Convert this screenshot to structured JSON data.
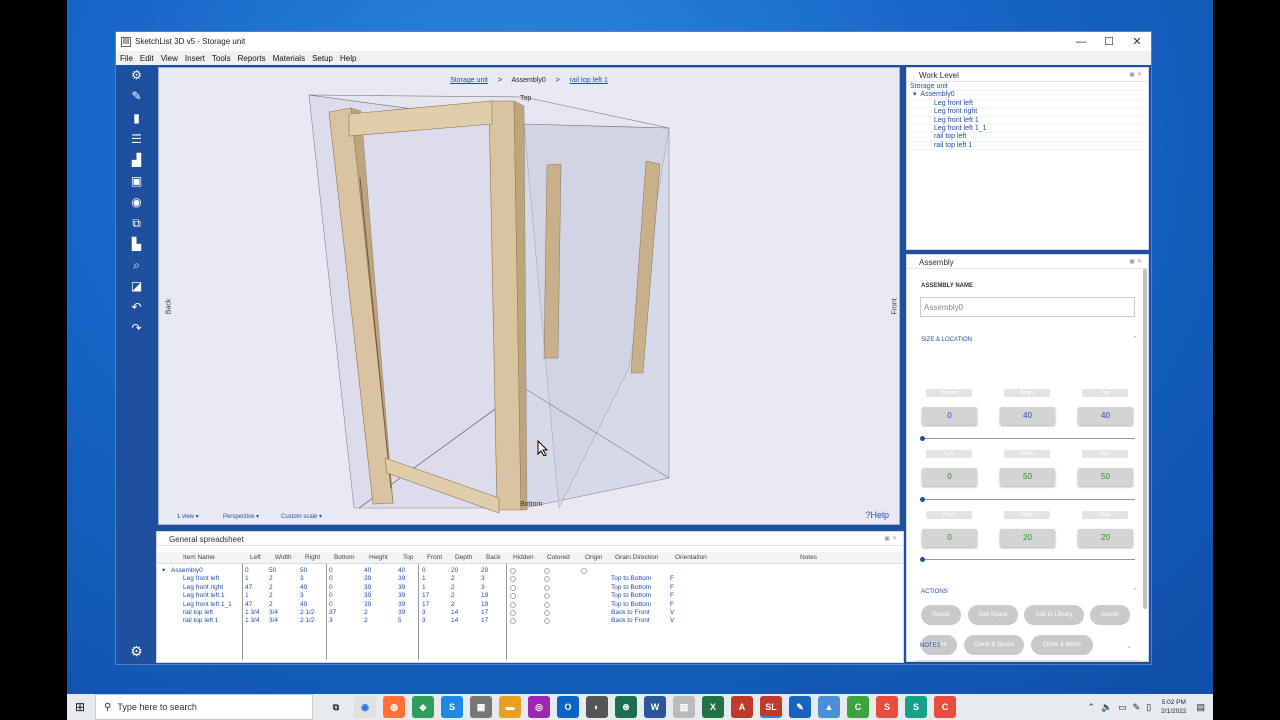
{
  "window": {
    "title": "SketchList 3D v5 - Storage unit",
    "controls": {
      "minimize": "—",
      "maximize": "☐",
      "close": "✕"
    }
  },
  "menu": [
    "File",
    "Edit",
    "View",
    "Insert",
    "Tools",
    "Reports",
    "Materials",
    "Setup",
    "Help"
  ],
  "viewport": {
    "breadcrumbs": [
      "Storage unit",
      "Assembly0",
      "rail top left 1"
    ],
    "crumb_sep": ">",
    "label_back": "Back",
    "label_front": "Front",
    "label_top": "Top",
    "label_bottom": "Bottom",
    "view_menu": "1 view",
    "projection_menu": "Perspective",
    "scale_menu": "Custom scale",
    "help": "?Help"
  },
  "work_level": {
    "title": "Work Level",
    "root": "Storage unit",
    "assembly": "Assembly0",
    "items": [
      "Leg front left",
      "Leg front right",
      "Leg front left 1",
      "Leg front left 1_1",
      "rail top left",
      "rail top left 1"
    ]
  },
  "assembly_panel": {
    "title": "Assembly",
    "name_label": "ASSEMBLY NAME",
    "name_value": "Assembly0",
    "size_section": "SIZE & LOCATION",
    "rows": [
      {
        "caps": [
          "Bottom",
          "Height",
          "Top"
        ],
        "values": [
          "0",
          "40",
          "40"
        ]
      },
      {
        "caps": [
          "Left",
          "Width",
          "Right"
        ],
        "values": [
          "0",
          "50",
          "50"
        ]
      },
      {
        "caps": [
          "Front",
          "Depth",
          "Back"
        ],
        "values": [
          "0",
          "20",
          "20"
        ]
      }
    ],
    "actions_section": "ACTIONS",
    "actions": [
      "Resize",
      "Add Space",
      "Add to Library",
      "Delete",
      "Clone",
      "Clone & Space",
      "Clone & Mirror"
    ],
    "notes_section": "NOTES"
  },
  "spreadsheet": {
    "title": "General spreadsheet",
    "columns": [
      "Item Name",
      "Left",
      "Width",
      "Right",
      "Bottom",
      "Height",
      "Top",
      "Front",
      "Depth",
      "Back",
      "Hidden",
      "Colored",
      "Origin",
      "Grain Direction",
      "Orientation",
      "Notes"
    ],
    "rows": [
      {
        "name": "Assembly0",
        "left": "0",
        "width": "50",
        "right": "50",
        "bottom": "0",
        "height": "40",
        "top": "40",
        "front": "0",
        "depth": "20",
        "back": "20",
        "grain": "",
        "orient": ""
      },
      {
        "name": "Leg front left",
        "left": "1",
        "width": "2",
        "right": "3",
        "bottom": "0",
        "height": "39",
        "top": "39",
        "front": "1",
        "depth": "2",
        "back": "3",
        "grain": "Top to Bottom",
        "orient": "F"
      },
      {
        "name": "Leg front right",
        "left": "47",
        "width": "2",
        "right": "49",
        "bottom": "0",
        "height": "39",
        "top": "39",
        "front": "1",
        "depth": "2",
        "back": "3",
        "grain": "Top to Bottom",
        "orient": "F"
      },
      {
        "name": "Leg front left 1",
        "left": "1",
        "width": "2",
        "right": "3",
        "bottom": "0",
        "height": "39",
        "top": "39",
        "front": "17",
        "depth": "2",
        "back": "19",
        "grain": "Top to Bottom",
        "orient": "F"
      },
      {
        "name": "Leg front left 1_1",
        "left": "47",
        "width": "2",
        "right": "49",
        "bottom": "0",
        "height": "39",
        "top": "39",
        "front": "17",
        "depth": "2",
        "back": "19",
        "grain": "Top to Bottom",
        "orient": "F"
      },
      {
        "name": "rail top left",
        "left": "1 3/4",
        "width": "3/4",
        "right": "2 1/2",
        "bottom": "37",
        "height": "2",
        "top": "39",
        "front": "3",
        "depth": "14",
        "back": "17",
        "grain": "Back to Front",
        "orient": "V"
      },
      {
        "name": "rail top left 1",
        "left": "1 3/4",
        "width": "3/4",
        "right": "2 1/2",
        "bottom": "3",
        "height": "2",
        "top": "5",
        "front": "3",
        "depth": "14",
        "back": "17",
        "grain": "Back to Front",
        "orient": "V"
      }
    ]
  },
  "taskbar": {
    "search_placeholder": "Type here to search",
    "time": "5:02 PM",
    "date": "2/1/2022"
  },
  "colors": {
    "accent": "#1f4f9f",
    "link": "#1f4fa5",
    "wood": "#d9c3a0"
  }
}
